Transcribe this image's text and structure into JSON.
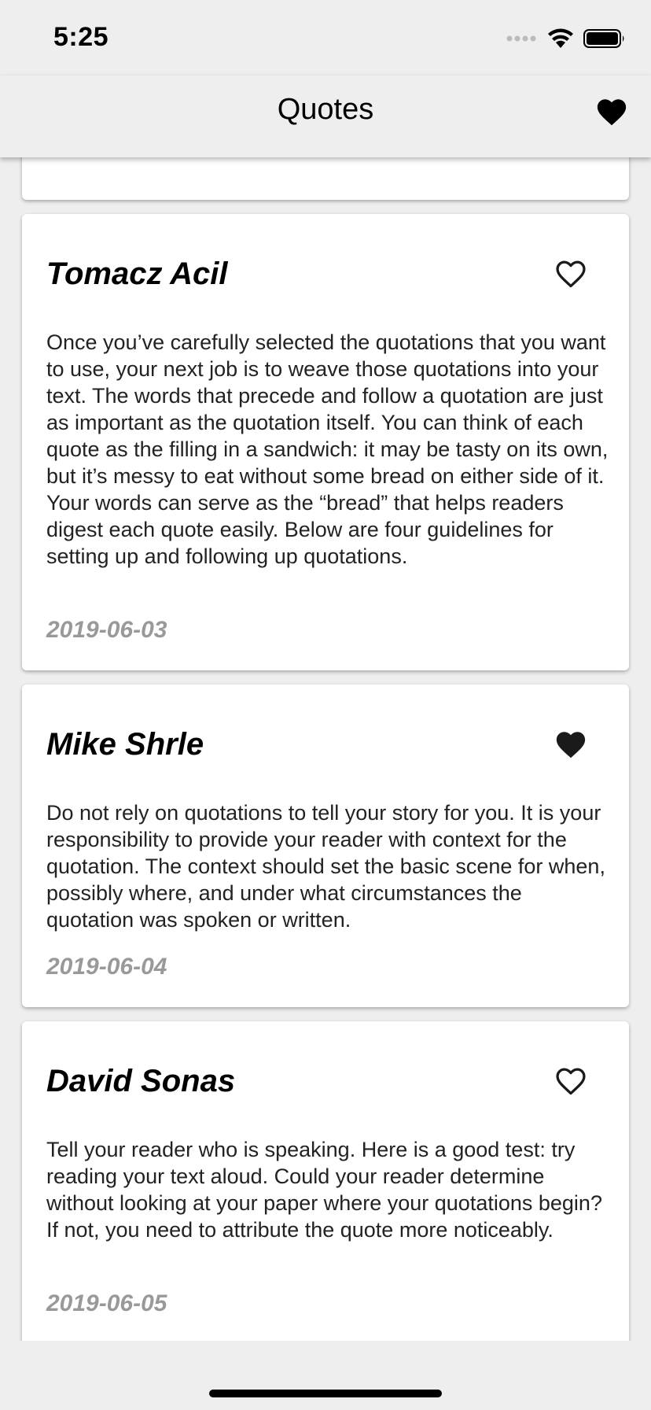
{
  "status_bar": {
    "time": "5:25"
  },
  "nav": {
    "title": "Quotes",
    "favorites_icon": "heart-filled-icon"
  },
  "quotes": [
    {
      "author": "Tomacz Acil",
      "text": "Once you’ve carefully selected the quotations that you want to use, your next job is to weave those quotations into your text. The words that precede and follow a quotation are just as important as the quotation itself. You can think of each quote as the filling in a sandwich: it may be tasty on its own, but it’s messy to eat without some bread on either side of it. Your words can serve as the “bread” that helps readers digest each quote easily. Below are four guidelines for setting up and following up quotations.",
      "date": "2019-06-03",
      "favorited": false
    },
    {
      "author": "Mike Shrle",
      "text": "Do not rely on quotations to tell your story for you. It is your responsibility to provide your reader with context for the quotation. The context should set the basic scene for when, possibly where, and under what circumstances the quotation was spoken or written.",
      "date": "2019-06-04",
      "favorited": true
    },
    {
      "author": "David Sonas",
      "text": "Tell your reader who is speaking. Here is a good test: try reading your text aloud. Could your reader determine without looking at your paper where your quotations begin? If not, you need to attribute the quote more noticeably.",
      "date": "2019-06-05",
      "favorited": false
    }
  ],
  "colors": {
    "background": "#eeeeee",
    "card": "#ffffff",
    "date": "#999999",
    "icon": "#1a1a1a"
  }
}
